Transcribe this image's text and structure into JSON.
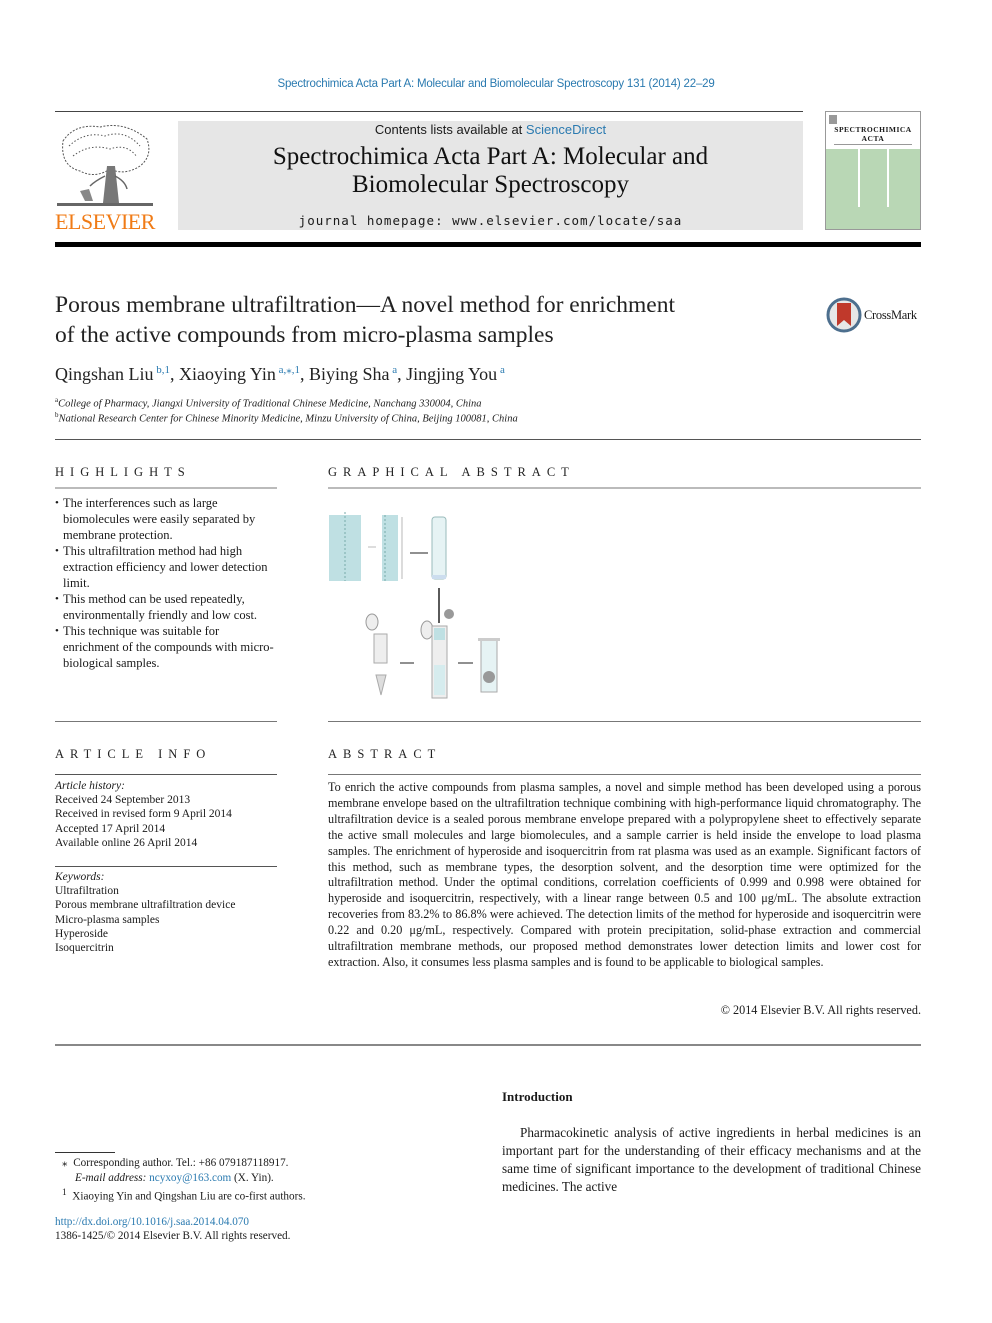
{
  "running_header": "Spectrochimica Acta Part A: Molecular and Biomolecular Spectroscopy 131 (2014) 22–29",
  "masthead": {
    "publisher_logo_text": "ELSEVIER",
    "contents_prefix": "Contents lists available at ",
    "contents_link": "ScienceDirect",
    "journal_title_line1": "Spectrochimica Acta Part A: Molecular and",
    "journal_title_line2": "Biomolecular Spectroscopy",
    "homepage": "journal homepage: www.elsevier.com/locate/saa",
    "cover_title_line1": "SPECTROCHIMICA",
    "cover_title_line2": "ACTA",
    "colors": {
      "elsevier_orange": "#f07b16",
      "link_blue": "#2a7ab0",
      "banner_gray": "#e6e6e6",
      "cover_green": "#b9d7b5"
    }
  },
  "article": {
    "title_line1": "Porous membrane ultrafiltration—A novel method for enrichment",
    "title_line2": "of the active compounds from micro-plasma samples",
    "crossmark_label": "CrossMark",
    "authors": [
      {
        "name": "Qingshan Liu",
        "sup": "b,1",
        "sep": ", "
      },
      {
        "name": "Xiaoying Yin",
        "sup": "a,⁎,1",
        "sep": ", "
      },
      {
        "name": "Biying Sha",
        "sup": "a",
        "sep": ", "
      },
      {
        "name": "Jingjing You",
        "sup": "a",
        "sep": ""
      }
    ],
    "affiliations": [
      {
        "mark": "a",
        "text": "College of Pharmacy, Jiangxi University of Traditional Chinese Medicine, Nanchang 330004, China"
      },
      {
        "mark": "b",
        "text": "National Research Center for Chinese Minority Medicine, Minzu University of China, Beijing 100081, China"
      }
    ]
  },
  "highlights": {
    "heading": "HIGHLIGHTS",
    "items": [
      "The interferences such as large biomolecules were easily separated by membrane protection.",
      "This ultrafiltration method had high extraction efficiency and lower detection limit.",
      "This method can be used repeatedly, environmentally friendly and low cost.",
      "This technique was suitable for enrichment of the compounds with micro-biological samples."
    ]
  },
  "graphical_abstract": {
    "heading": "GRAPHICAL ABSTRACT"
  },
  "article_info": {
    "heading": "ARTICLE INFO",
    "history_label": "Article history:",
    "history": [
      "Received 24 September 2013",
      "Received in revised form 9 April 2014",
      "Accepted 17 April 2014",
      "Available online 26 April 2014"
    ],
    "keywords_label": "Keywords:",
    "keywords": [
      "Ultrafiltration",
      "Porous membrane ultrafiltration device",
      "Micro-plasma samples",
      "Hyperoside",
      "Isoquercitrin"
    ]
  },
  "abstract": {
    "heading": "ABSTRACT",
    "text": "To enrich the active compounds from plasma samples, a novel and simple method has been developed using a porous membrane envelope based on the ultrafiltration technique combining with high-performance liquid chromatography. The ultrafiltration device is a sealed porous membrane envelope prepared with a polypropylene sheet to effectively separate the active small molecules and large biomolecules, and a sample carrier is held inside the envelope to load plasma samples. The enrichment of hyperoside and isoquercitrin from rat plasma was used as an example. Significant factors of this method, such as membrane types, the desorption solvent, and the desorption time were optimized for the ultrafiltration method. Under the optimal conditions, correlation coefficients of 0.999 and 0.998 were obtained for hyperoside and isoquercitrin, respectively, with a linear range between 0.5 and 100 μg/mL. The absolute extraction recoveries from 83.2% to 86.8% were achieved. The detection limits of the method for hyperoside and isoquercitrin were 0.22 and 0.20 μg/mL, respectively. Compared with protein precipitation, solid-phase extraction and commercial ultrafiltration membrane methods, our proposed method demonstrates lower detection limits and lower cost for extraction. Also, it consumes less plasma samples and is found to be applicable to biological samples.",
    "copyright": "© 2014 Elsevier B.V. All rights reserved."
  },
  "introduction": {
    "heading": "Introduction",
    "text": "Pharmacokinetic analysis of active ingredients in herbal medicines is an important part for the understanding of their efficacy mechanisms and at the same time of significant importance to the development of traditional Chinese medicines. The active"
  },
  "footnotes": {
    "corresponding": "Corresponding author. Tel.: +86 079187118917.",
    "corresponding_mark": "⁎",
    "email_label": "E-mail address: ",
    "email": "ncyxoy@163.com",
    "email_suffix": " (X. Yin).",
    "cofirst_mark": "1",
    "cofirst": "Xiaoying Yin and Qingshan Liu are co-first authors.",
    "doi": "http://dx.doi.org/10.1016/j.saa.2014.04.070",
    "issn": "1386-1425/© 2014 Elsevier B.V. All rights reserved."
  }
}
